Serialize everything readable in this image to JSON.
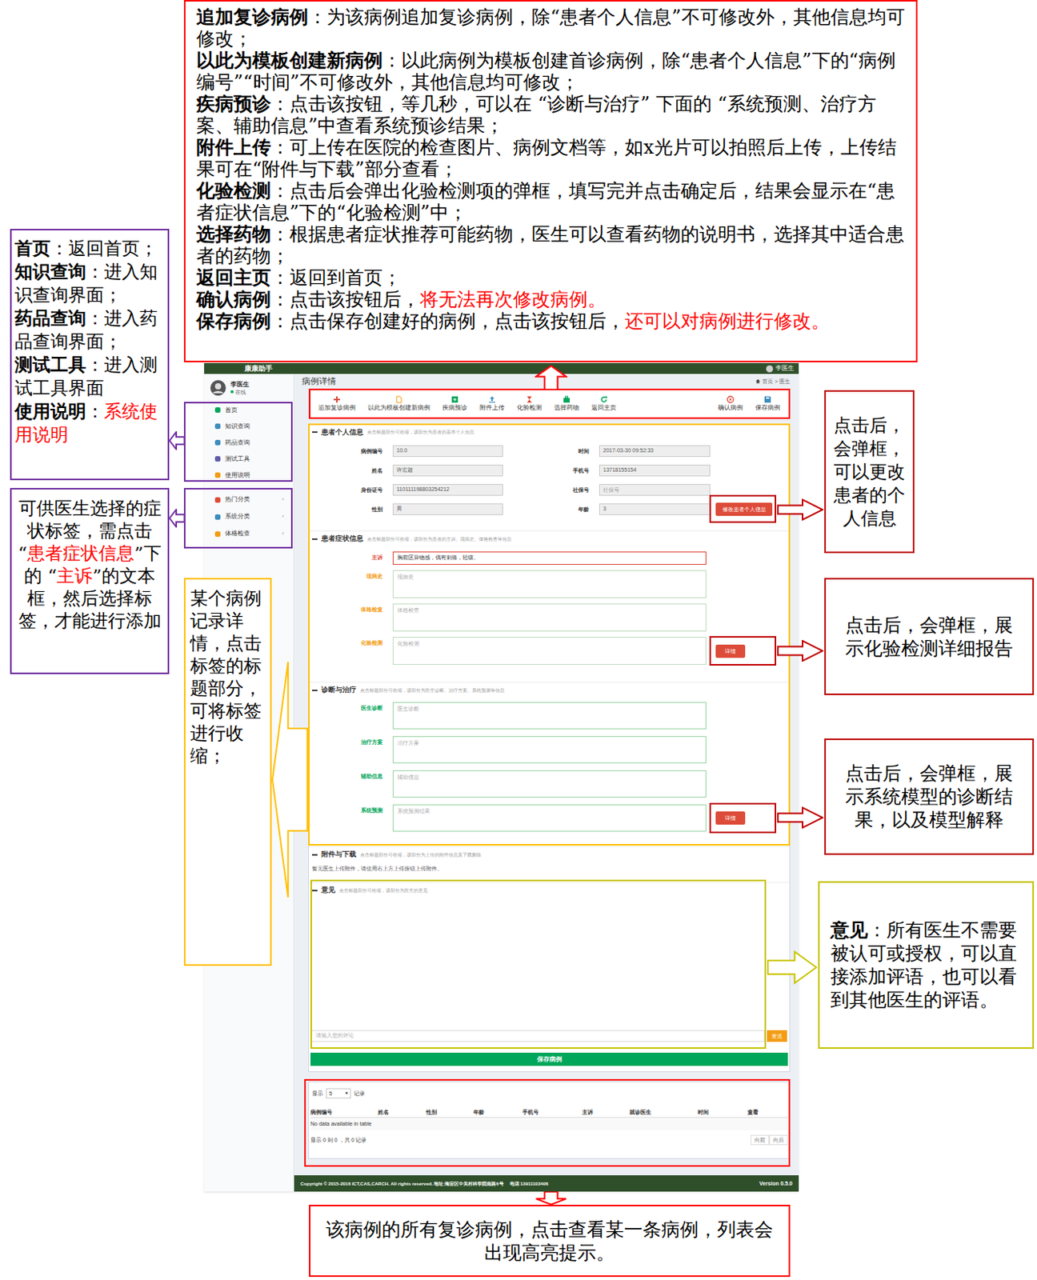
{
  "annotations": {
    "toolbar_notes": [
      {
        "parts": [
          {
            "text": "追加复诊病例",
            "kind": "term"
          },
          {
            "text": "：为该病例追加复诊病例，除“患者个人信息”不可修改外，其他信息均可修改；",
            "kind": "plain"
          }
        ]
      },
      {
        "parts": [
          {
            "text": "以此为模板创建新病例",
            "kind": "term"
          },
          {
            "text": "：以此病例为模板创建首诊病例，除“患者个人信息”下的“病例编号”“时间”不可修改外，其他信息均可修改；",
            "kind": "plain"
          }
        ]
      },
      {
        "parts": [
          {
            "text": "疾病预诊",
            "kind": "term"
          },
          {
            "text": "：点击该按钮，等几秒，可以在 “诊断与治疗” 下面的 “系统预测、治疗方案、辅助信息”中查看系统预诊结果；",
            "kind": "plain"
          }
        ]
      },
      {
        "parts": [
          {
            "text": "附件上传",
            "kind": "term"
          },
          {
            "text": "：可上传在医院的检查图片、病例文档等，如x光片可以拍照后上传，上传结果可在“附件与下载”部分查看；",
            "kind": "plain"
          }
        ]
      },
      {
        "parts": [
          {
            "text": "化验检测",
            "kind": "term"
          },
          {
            "text": "：点击后会弹出化验检测项的弹框，填写完并点击确定后，结果会显示在“患者症状信息”下的“化验检测”中；",
            "kind": "plain"
          }
        ]
      },
      {
        "parts": [
          {
            "text": "选择药物",
            "kind": "term"
          },
          {
            "text": "：根据患者症状推荐可能药物，医生可以查看药物的说明书，选择其中适合患者的药物；",
            "kind": "plain"
          }
        ]
      },
      {
        "parts": [
          {
            "text": "返回主页",
            "kind": "term"
          },
          {
            "text": "：返回到首页；",
            "kind": "plain"
          }
        ]
      },
      {
        "parts": [
          {
            "text": "确认病例",
            "kind": "term"
          },
          {
            "text": "：点击该按钮后，",
            "kind": "plain"
          },
          {
            "text": "将无法再次修改病例。",
            "kind": "red"
          }
        ]
      },
      {
        "parts": [
          {
            "text": "保存病例",
            "kind": "term"
          },
          {
            "text": "：点击保存创建好的病例，点击该按钮后，",
            "kind": "plain"
          },
          {
            "text": "还可以对病例进行修改。",
            "kind": "red"
          }
        ]
      }
    ],
    "nav_notes": [
      {
        "parts": [
          {
            "text": "首页",
            "kind": "term"
          },
          {
            "text": "：返回首页；",
            "kind": "plain"
          }
        ]
      },
      {
        "parts": [
          {
            "text": "知识查询",
            "kind": "term"
          },
          {
            "text": "：进入知识查询界面；",
            "kind": "plain"
          }
        ]
      },
      {
        "parts": [
          {
            "text": "药品查询",
            "kind": "term"
          },
          {
            "text": "：进入药品查询界面；",
            "kind": "plain"
          }
        ]
      },
      {
        "parts": [
          {
            "text": "测试工具",
            "kind": "term"
          },
          {
            "text": "：进入测试工具界面",
            "kind": "plain"
          }
        ]
      },
      {
        "parts": [
          {
            "text": "使用说明",
            "kind": "term"
          },
          {
            "text": "：",
            "kind": "plain"
          },
          {
            "text": "系统使用说明",
            "kind": "red"
          }
        ]
      }
    ],
    "tag_note": [
      {
        "text": "可供医生选择的症状标签，需点击“",
        "kind": "plain"
      },
      {
        "text": "患者症状信息",
        "kind": "red"
      },
      {
        "text": "”下的 “",
        "kind": "plain"
      },
      {
        "text": "主诉",
        "kind": "red"
      },
      {
        "text": "”的文本框，然后选择标签，才能进行添加",
        "kind": "plain"
      }
    ],
    "section_note": "某个病例记录详情，点击标签的标题部分，可将标签进行收缩；",
    "edit_note": "点击后，会弹框，可以更改患者的个人信息",
    "lab_note": "点击后，会弹框，展示化验检测详细报告",
    "predict_note": "点击后，会弹框，展示系统模型的诊断结果，以及模型解释",
    "opinion_note": [
      {
        "text": "意见",
        "kind": "term"
      },
      {
        "text": "：所有医生不需要被认可或授权，可以直接添加评语，也可以看到其他医生的评语。",
        "kind": "plain"
      }
    ],
    "followup_note": "该病例的所有复诊病例，点击查看某一条病例，列表会出现高亮提示。"
  },
  "app": {
    "brand": "康康助手",
    "user_menu": "李医生",
    "profile": {
      "name": "李医生",
      "status": "在线"
    },
    "nav": [
      {
        "label": "首页",
        "color": "#00a65a"
      },
      {
        "label": "知识查询",
        "color": "#3c8dbc"
      },
      {
        "label": "药品查询",
        "color": "#3c8dbc"
      },
      {
        "label": "测试工具",
        "color": "#605ca8"
      },
      {
        "label": "使用说明",
        "color": "#f39c12"
      }
    ],
    "categories": [
      {
        "label": "热门分类",
        "color": "#dd4b39",
        "chevron": "‹"
      },
      {
        "label": "系统分类",
        "color": "#3c8dbc",
        "chevron": "‹"
      },
      {
        "label": "体格检查",
        "color": "#f39c12",
        "chevron": "‹"
      }
    ],
    "page_title": "病例详情",
    "breadcrumb": {
      "home": "首页",
      "separator": ">",
      "current": "医生"
    },
    "toolbar": {
      "left": [
        {
          "label": "追加复诊病例",
          "color": "#dd4b39"
        },
        {
          "label": "以此为模板创建新病例",
          "color": "#f39c12"
        },
        {
          "label": "疾病预诊",
          "color": "#00a65a"
        },
        {
          "label": "附件上传",
          "color": "#3c8dbc"
        },
        {
          "label": "化验检测",
          "color": "#dd4b39"
        },
        {
          "label": "选择药物",
          "color": "#00a65a"
        },
        {
          "label": "返回主页",
          "color": "#00a65a"
        }
      ],
      "right": [
        {
          "label": "确认病例",
          "color": "#dd4b39"
        },
        {
          "label": "保存病例",
          "color": "#3c8dbc"
        }
      ]
    },
    "patient": {
      "title": "患者个人信息",
      "hint": "点击标题部分可收缩，该部分为患者的基本个人信息",
      "fields": [
        {
          "label": "病例编号",
          "value": "10.0",
          "kind": "value"
        },
        {
          "label": "时间",
          "value": "2017-03-30 09:52:33",
          "kind": "value"
        },
        {
          "label": "姓名",
          "value": "许宏超",
          "kind": "value"
        },
        {
          "label": "手机号",
          "value": "13718155154",
          "kind": "value"
        },
        {
          "label": "身份证号",
          "value": "110111198803254212",
          "kind": "value"
        },
        {
          "label": "社保号",
          "placeholder": "社保号",
          "kind": "placeholder"
        },
        {
          "label": "性别",
          "value": "男",
          "kind": "value"
        },
        {
          "label": "年龄",
          "value": "3",
          "kind": "value"
        }
      ],
      "edit_button": "修改患者个人信息"
    },
    "symptoms": {
      "title": "患者症状信息",
      "hint": "点击标题部分可收缩，该部分为患者的主诉、现病史、体格检查等信息",
      "fields": [
        {
          "label": "主诉",
          "value": "胸前区异物感，偶有刺痛，轻咳。",
          "kind": "value",
          "color": "#dd4b39"
        },
        {
          "label": "现病史",
          "placeholder": "现病史",
          "kind": "placeholder",
          "color": "#f39c12"
        },
        {
          "label": "体格检查",
          "placeholder": "体格检查",
          "kind": "placeholder",
          "color": "#f39c12"
        },
        {
          "label": "化验检测",
          "placeholder": "化验检测",
          "kind": "placeholder",
          "color": "#f39c12",
          "button": "详情"
        }
      ]
    },
    "diagnosis": {
      "title": "诊断与治疗",
      "hint": "点击标题部分可收缩，该部分为医生诊断、治疗方案、系统预测等信息",
      "fields": [
        {
          "label": "医生诊断",
          "placeholder": "医生诊断",
          "kind": "placeholder",
          "color": "#00a65a"
        },
        {
          "label": "治疗方案",
          "placeholder": "治疗方案",
          "kind": "placeholder",
          "color": "#00a65a"
        },
        {
          "label": "辅助信息",
          "placeholder": "辅助信息",
          "kind": "placeholder",
          "color": "#00a65a"
        },
        {
          "label": "系统预测",
          "placeholder": "系统预测结果",
          "kind": "placeholder",
          "color": "#00a65a",
          "button": "详情"
        }
      ]
    },
    "attachments": {
      "title": "附件与下载",
      "hint": "点击标题部分可收缩，该部分为上传的附件信息及下载删除",
      "empty": "暂无医生上传附件，请使用右上方上传按钮上传附件。"
    },
    "opinion": {
      "title": "意见",
      "hint": "点击标题部分可收缩，该部分为医生的意见",
      "placeholder": "请输入您的评论",
      "send": "发送"
    },
    "save": "保存病例",
    "followups": {
      "length": {
        "pre": "显示",
        "value": "5",
        "caret": "▾",
        "post": "记录"
      },
      "columns": [
        "病例编号",
        "姓名",
        "性别",
        "年龄",
        "手机号",
        "主诉",
        "就诊医生",
        "时间",
        "查看"
      ],
      "empty": "No data available in table",
      "info": "显示 0 到 0 ，共 0 记录",
      "pager": [
        "向前",
        "向后"
      ]
    },
    "footer": {
      "copyright": "Copyright © 2015-2016 ICT,CAS,CARCH. All rights reserved. 地址:海淀区中关村科学院南路6号",
      "phone": "电话 13911103406",
      "version": "Version 0.5.0"
    }
  }
}
